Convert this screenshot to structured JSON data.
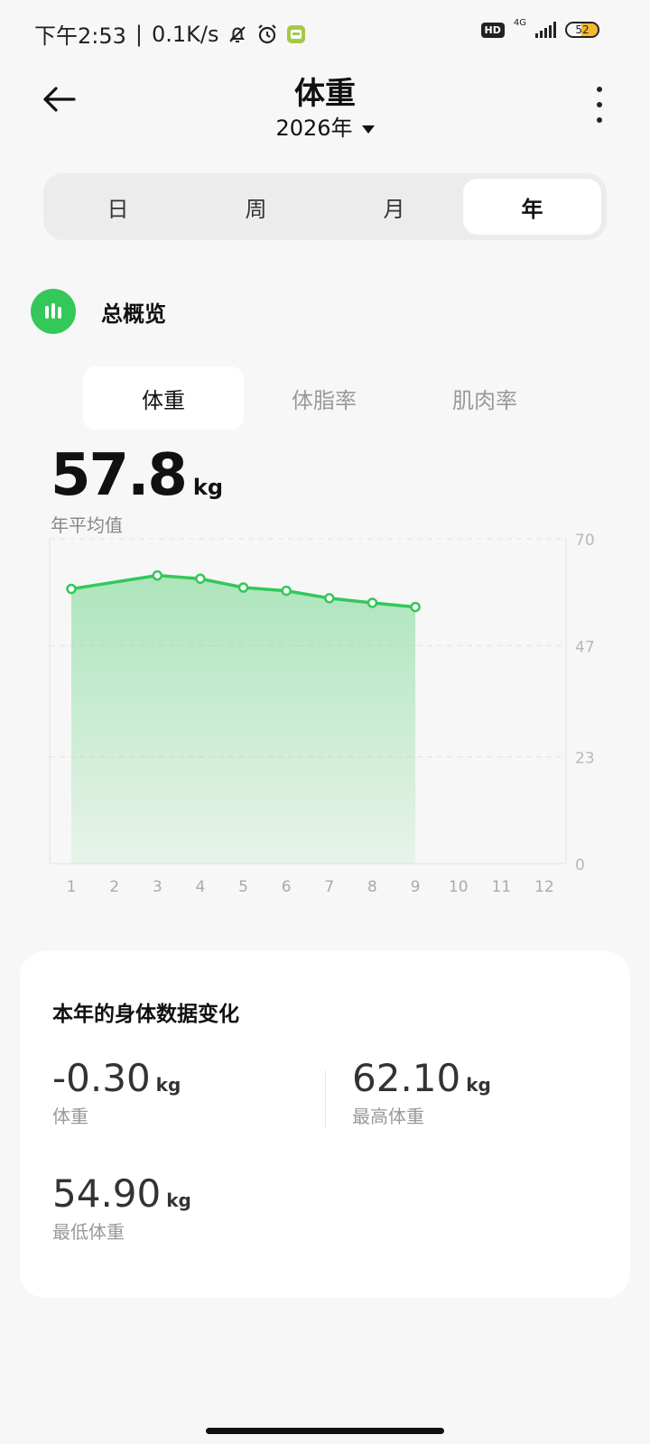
{
  "status_bar": {
    "time": "下午2:53",
    "separator": "|",
    "speed": "0.1K/s",
    "hd": "HD",
    "network": "4G",
    "battery": "52",
    "battery_level": 0.52,
    "icons": [
      "bell-off-icon",
      "alarm-icon",
      "app-notification-icon",
      "signal-icon",
      "battery-icon"
    ]
  },
  "header": {
    "title": "体重",
    "year": "2026年",
    "back_icon": "arrow-left-icon",
    "more_icon": "more-vertical-icon"
  },
  "period_tabs": [
    {
      "label": "日",
      "active": false
    },
    {
      "label": "周",
      "active": false
    },
    {
      "label": "月",
      "active": false
    },
    {
      "label": "年",
      "active": true
    }
  ],
  "overview": {
    "label": "总概览",
    "icon": "bar-chart-icon",
    "accent": "#34c759"
  },
  "metric_tabs": [
    {
      "label": "体重",
      "active": true
    },
    {
      "label": "体脂率",
      "active": false
    },
    {
      "label": "肌肉率",
      "active": false
    }
  ],
  "summary": {
    "value": "57.8",
    "unit": "kg",
    "label": "年平均值"
  },
  "chart_data": {
    "type": "area",
    "x": [
      1,
      2,
      3,
      4,
      5,
      6,
      7,
      8,
      9,
      10,
      11,
      12
    ],
    "x_tick_labels": [
      "1",
      "2",
      "3",
      "4",
      "5",
      "6",
      "7",
      "8",
      "9",
      "10",
      "11",
      "12"
    ],
    "series": [
      {
        "x": [
          1,
          3,
          4,
          5,
          6,
          7,
          8,
          9
        ],
        "values": [
          59.2,
          62.1,
          61.4,
          59.5,
          58.8,
          57.2,
          56.2,
          55.3
        ]
      }
    ],
    "ylim": [
      0,
      70
    ],
    "y_ticks": [
      0,
      23,
      47,
      70
    ],
    "y_tick_labels": [
      "0",
      "23",
      "47",
      "70"
    ],
    "y_axis_position": "right",
    "grid": true,
    "color": "#34c759"
  },
  "card": {
    "title": "本年的身体数据变化",
    "stats": [
      {
        "value": "-0.30",
        "unit": "kg",
        "label": "体重"
      },
      {
        "value": "62.10",
        "unit": "kg",
        "label": "最高体重"
      },
      {
        "value": "54.90",
        "unit": "kg",
        "label": "最低体重"
      }
    ]
  }
}
